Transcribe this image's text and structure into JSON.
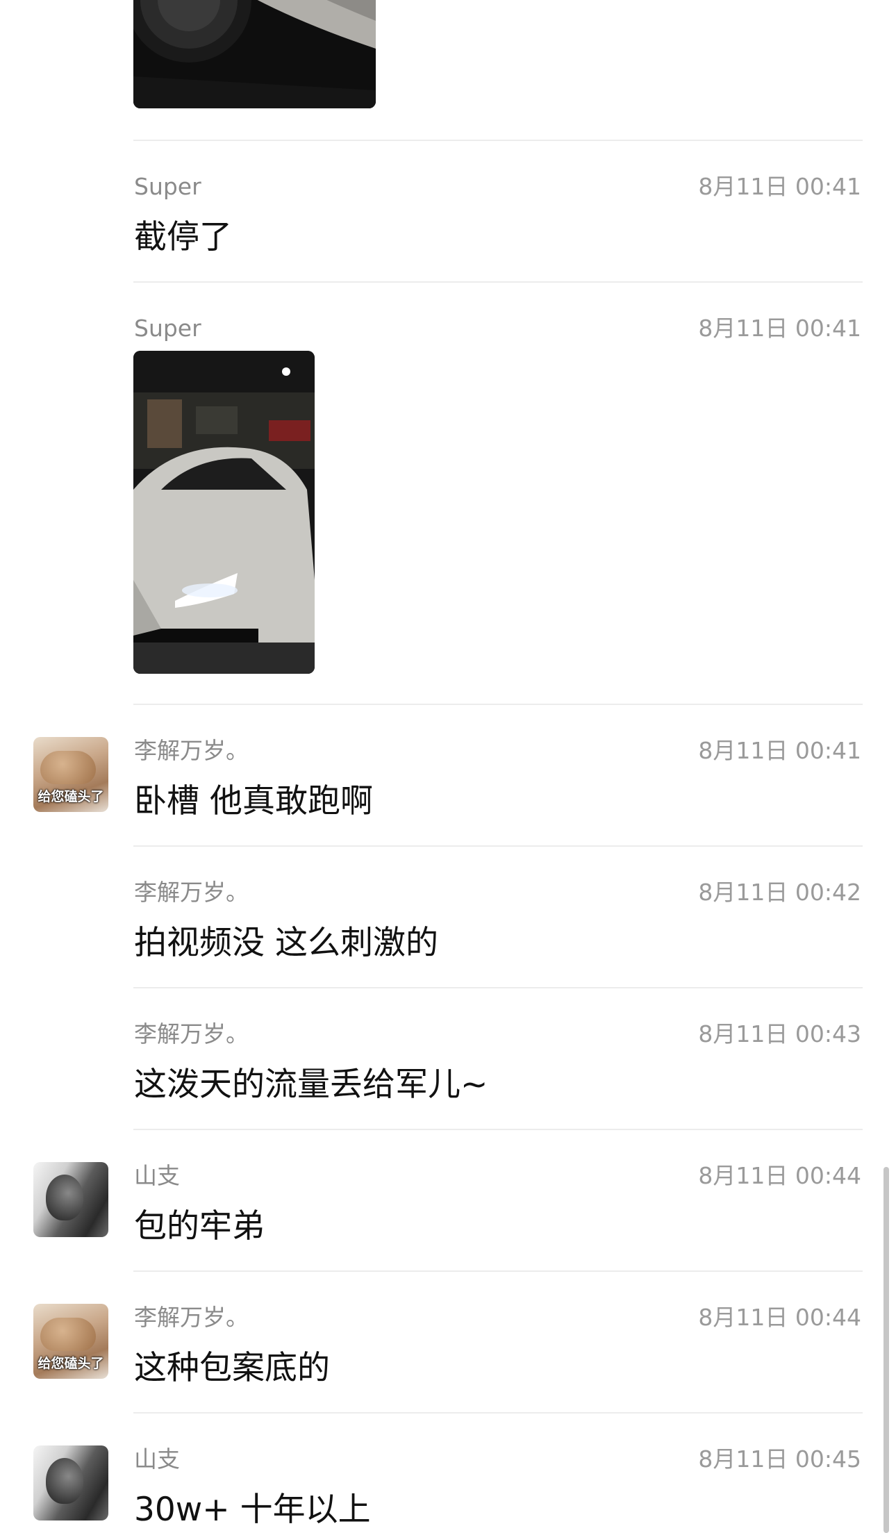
{
  "messages": [
    {
      "sender": "Super",
      "time": "8月11日 00:41",
      "text": "截停了"
    },
    {
      "sender": "Super",
      "time": "8月11日 00:41",
      "text": ""
    },
    {
      "sender": "李解万岁。",
      "time": "8月11日 00:41",
      "text": "卧槽  他真敢跑啊",
      "avatar_label": "给您磕头了"
    },
    {
      "sender": "李解万岁。",
      "time": "8月11日 00:42",
      "text": "拍视频没  这么刺激的"
    },
    {
      "sender": "李解万岁。",
      "time": "8月11日 00:43",
      "text": "这泼天的流量丢给军儿~"
    },
    {
      "sender": "山支",
      "time": "8月11日 00:44",
      "text": "包的牢弟"
    },
    {
      "sender": "李解万岁。",
      "time": "8月11日 00:44",
      "text": "这种包案底的",
      "avatar_label": "给您磕头了"
    },
    {
      "sender": "山支",
      "time": "8月11日 00:45",
      "text": "30w+ 十年以上"
    }
  ],
  "colors": {
    "background": "#ffffff",
    "divider": "#ececec",
    "sender": "#8a8a8a",
    "time": "#9a9a9a",
    "text": "#111111"
  }
}
